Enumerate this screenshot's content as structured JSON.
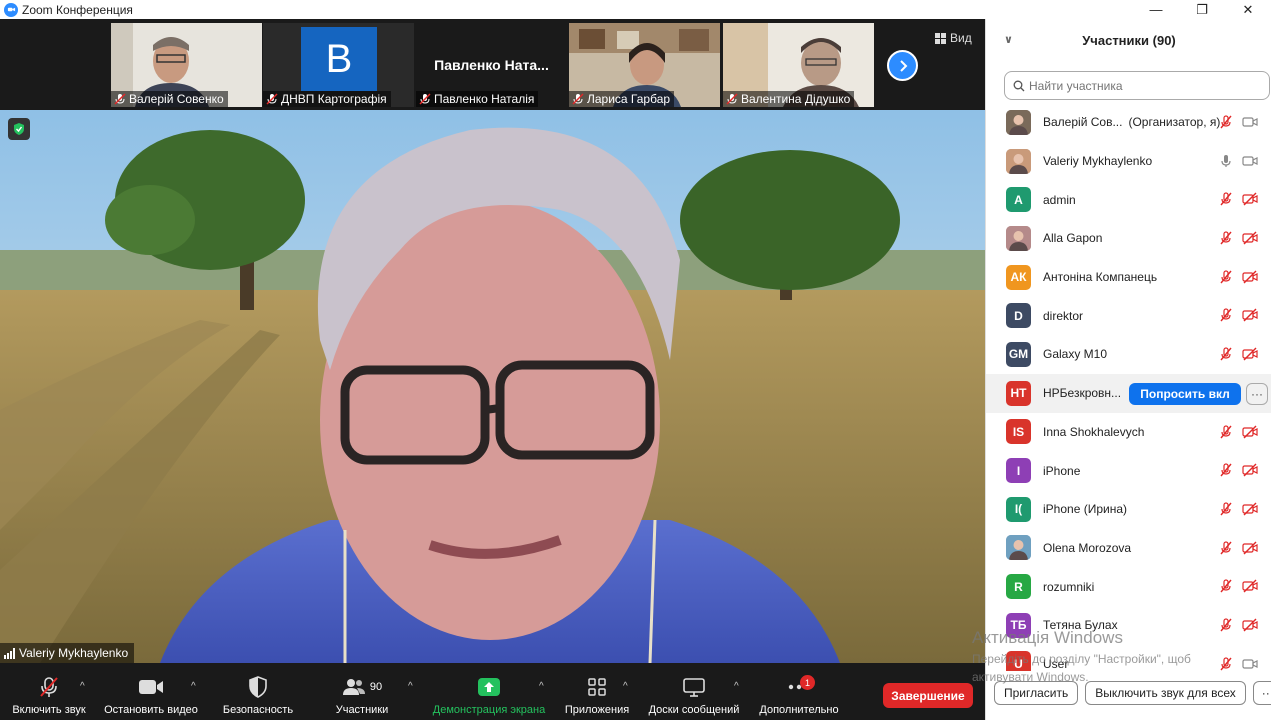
{
  "window": {
    "title": "Zoom Конференция",
    "controls": [
      "—",
      "❐",
      "✕"
    ]
  },
  "thumbnails": [
    {
      "name": "Валерій Совенко",
      "type": "video"
    },
    {
      "name": "ДНВП Картографія",
      "type": "logo",
      "logo_letter": "B"
    },
    {
      "name": "Павленко Наталія",
      "type": "name",
      "display": "Павленко  Ната..."
    },
    {
      "name": "Лариса Гарбар",
      "type": "video"
    },
    {
      "name": "Валентина Дідушко",
      "type": "video"
    }
  ],
  "view_label": "Вид",
  "active_speaker": "Valeriy Mykhaylenko",
  "toolbar": {
    "unmute": "Включить звук",
    "video": "Остановить видео",
    "security": "Безопасность",
    "participants": "Участники",
    "participants_count": "90",
    "share": "Демонстрация экрана",
    "apps": "Приложения",
    "whiteboard": "Доски сообщений",
    "more": "Дополнительно",
    "more_badge": "1",
    "end": "Завершение"
  },
  "panel": {
    "title": "Участники (90)",
    "search_placeholder": "Найти участника",
    "participants": [
      {
        "name": "Валерій Сов...",
        "role": "(Организатор, я)",
        "initials": "",
        "color": "#7a6a5a",
        "photo": true,
        "mic": "muted",
        "cam": "on"
      },
      {
        "name": "Valeriy Mykhaylenko",
        "role": "",
        "initials": "",
        "color": "#c99a7a",
        "photo": true,
        "mic": "on",
        "cam": "on"
      },
      {
        "name": "admin",
        "role": "",
        "initials": "A",
        "color": "#1f9a6f",
        "mic": "muted",
        "cam": "off"
      },
      {
        "name": "Alla Gapon",
        "role": "",
        "initials": "",
        "color": "#b58a8a",
        "photo": true,
        "mic": "muted",
        "cam": "off"
      },
      {
        "name": "Антоніна Компанець",
        "role": "",
        "initials": "АК",
        "color": "#f0961f",
        "mic": "muted",
        "cam": "off"
      },
      {
        "name": "direktor",
        "role": "",
        "initials": "D",
        "color": "#3d4a63",
        "mic": "muted",
        "cam": "off"
      },
      {
        "name": "Galaxy M10",
        "role": "",
        "initials": "GM",
        "color": "#3d4a63",
        "mic": "muted",
        "cam": "off"
      },
      {
        "name": "НРБезкровн...",
        "role": "",
        "initials": "НТ",
        "color": "#d9342b",
        "highlight": true,
        "ask_label": "Попросить вкл",
        "more": "···"
      },
      {
        "name": "Inna Shokhalevych",
        "role": "",
        "initials": "IS",
        "color": "#d9342b",
        "mic": "muted",
        "cam": "off"
      },
      {
        "name": "iPhone",
        "role": "",
        "initials": "I",
        "color": "#8e3fb5",
        "mic": "muted",
        "cam": "off"
      },
      {
        "name": "iPhone (Ирина)",
        "role": "",
        "initials": "I(",
        "color": "#1f9a6f",
        "mic": "muted",
        "cam": "off"
      },
      {
        "name": "Olena Morozova",
        "role": "",
        "initials": "",
        "color": "#6fa0c0",
        "photo": true,
        "mic": "muted",
        "cam": "off"
      },
      {
        "name": "rozumniki",
        "role": "",
        "initials": "R",
        "color": "#27a844",
        "mic": "muted",
        "cam": "off"
      },
      {
        "name": "Тетяна Булах",
        "role": "",
        "initials": "ТБ",
        "color": "#8e3fb5",
        "mic": "muted",
        "cam": "off"
      },
      {
        "name": "User",
        "role": "",
        "initials": "U",
        "color": "#d9342b",
        "mic": "muted",
        "cam": "on"
      }
    ],
    "invite": "Пригласить",
    "mute_all": "Выключить звук для всех",
    "more": "···"
  },
  "activation": {
    "title": "Активація Windows",
    "line1": "Перейдіть до розділу \"Настройки\", щоб",
    "line2": "активувати Windows."
  }
}
